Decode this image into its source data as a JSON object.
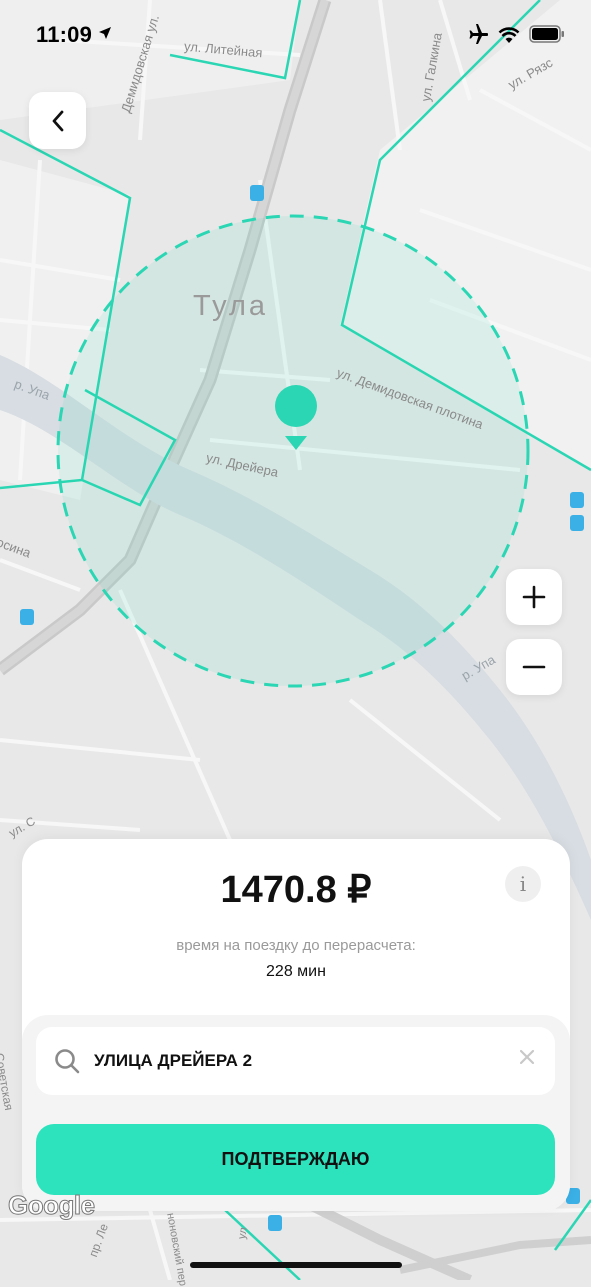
{
  "status_bar": {
    "time": "11:09"
  },
  "map": {
    "city_label": "Тула",
    "streets": {
      "liteynaya": "ул. Литейная",
      "demidovskaya": "Демидовская ул.",
      "galkina": "ул. Галкина",
      "ryazanskaya": "ул. Рязс",
      "demidovskaya_plotina": "ул. Демидовская плотина",
      "dreyera": "ул. Дрейера",
      "sina": "осина",
      "river_ula_1": "р. Упа",
      "river_ula_2": "р. Упа",
      "street_left": "ул. С",
      "sovetskaya": "Советская",
      "lenina": "пр. Ле",
      "konovsky": "ноновский пер",
      "street_bottom": "ул"
    },
    "accent_color": "#2ad6b3"
  },
  "controls": {
    "back_icon": "chevron-left-icon",
    "zoom_in_icon": "plus-icon",
    "zoom_out_icon": "minus-icon"
  },
  "panel": {
    "price": "1470.8 ₽",
    "info_label": "i",
    "recalc_label": "время на поездку до перерасчета:",
    "recalc_value": "228 мин",
    "search": {
      "value": "УЛИЦА ДРЕЙЕРА 2",
      "icon": "search-icon",
      "clear_icon": "close-icon"
    },
    "confirm_label": "ПОДТВЕРЖДАЮ",
    "confirm_color": "#2ce3bd"
  },
  "attribution": "Google"
}
